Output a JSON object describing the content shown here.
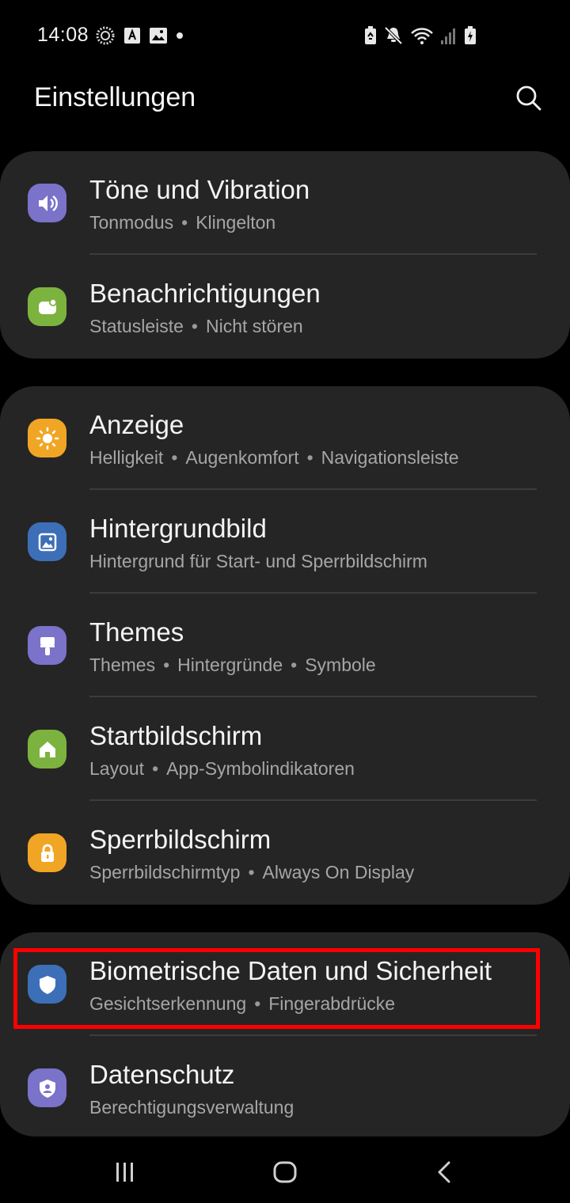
{
  "status_bar": {
    "time": "14:08",
    "left_icons": [
      "sync-icon",
      "a-badge-icon",
      "gallery-icon",
      "dot-icon"
    ],
    "right_icons": [
      "battery-saver-icon",
      "mute-icon",
      "wifi-icon",
      "signal-icon",
      "battery-charging-icon"
    ]
  },
  "header": {
    "title": "Einstellungen",
    "search_icon": "search-icon"
  },
  "groups": [
    {
      "items": [
        {
          "title": "Töne und Vibration",
          "sub1": "Tonmodus",
          "sub2": "Klingelton",
          "icon": "sound-icon",
          "color": "#7b72c9"
        },
        {
          "title": "Benachrichtigungen",
          "sub1": "Statusleiste",
          "sub2": "Nicht stören",
          "icon": "notifications-icon",
          "color": "#7cb33f"
        }
      ]
    },
    {
      "items": [
        {
          "title": "Anzeige",
          "sub1": "Helligkeit",
          "sub2": "Augenkomfort",
          "sub3": "Navigationsleiste",
          "icon": "display-icon",
          "color": "#f0a624"
        },
        {
          "title": "Hintergrundbild",
          "sub1": "Hintergrund für Start- und Sperrbildschirm",
          "icon": "wallpaper-icon",
          "color": "#3d6fb8"
        },
        {
          "title": "Themes",
          "sub1": "Themes",
          "sub2": "Hintergründe",
          "sub3": "Symbole",
          "icon": "themes-icon",
          "color": "#7b72c9"
        },
        {
          "title": "Startbildschirm",
          "sub1": "Layout",
          "sub2": "App-Symbolindikatoren",
          "icon": "home-screen-icon",
          "color": "#7cb33f"
        },
        {
          "title": "Sperrbildschirm",
          "sub1": "Sperrbildschirmtyp",
          "sub2": "Always On Display",
          "icon": "lock-icon",
          "color": "#f0a624"
        }
      ]
    },
    {
      "items": [
        {
          "title": "Biometrische Daten und Sicherheit",
          "sub1": "Gesichtserkennung",
          "sub2": "Fingerabdrücke",
          "icon": "shield-icon",
          "color": "#3d6fb8"
        },
        {
          "title": "Datenschutz",
          "sub1": "Berechtigungsverwaltung",
          "icon": "privacy-icon",
          "color": "#7b72c9"
        }
      ]
    }
  ],
  "separator": "•",
  "nav": {
    "recent": "recent-apps-icon",
    "home": "home-icon",
    "back": "back-icon"
  },
  "highlight_color": "#ff0000"
}
